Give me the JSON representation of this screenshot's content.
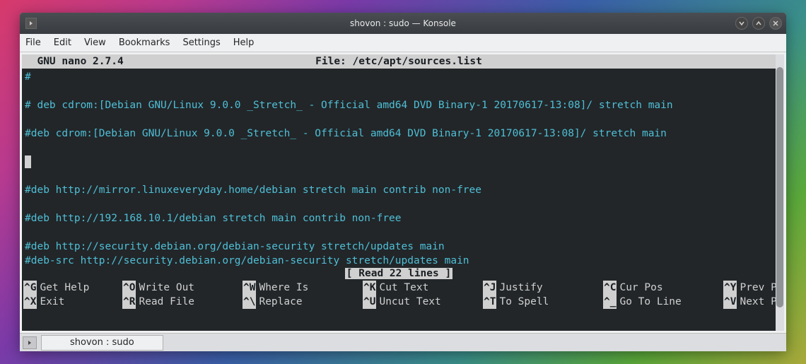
{
  "window": {
    "title": "shovon : sudo — Konsole"
  },
  "menubar": {
    "items": [
      "File",
      "Edit",
      "View",
      "Bookmarks",
      "Settings",
      "Help"
    ]
  },
  "nano": {
    "app_name": "  GNU nano 2.7.4",
    "file_label": "File: /etc/apt/sources.list",
    "lines": [
      "#",
      "",
      "# deb cdrom:[Debian GNU/Linux 9.0.0 _Stretch_ - Official amd64 DVD Binary-1 20170617-13:08]/ stretch main",
      "",
      "#deb cdrom:[Debian GNU/Linux 9.0.0 _Stretch_ - Official amd64 DVD Binary-1 20170617-13:08]/ stretch main",
      "",
      "",
      "",
      "#deb http://mirror.linuxeveryday.home/debian stretch main contrib non-free",
      "",
      "#deb http://192.168.10.1/debian stretch main contrib non-free",
      "",
      "#deb http://security.debian.org/debian-security stretch/updates main",
      "#deb-src http://security.debian.org/debian-security stretch/updates main"
    ],
    "cursor_line_index": 6,
    "status": "[ Read 22 lines ]",
    "shortcuts": [
      {
        "key": "^G",
        "label": "Get Help"
      },
      {
        "key": "^O",
        "label": "Write Out"
      },
      {
        "key": "^W",
        "label": "Where Is"
      },
      {
        "key": "^K",
        "label": "Cut Text"
      },
      {
        "key": "^J",
        "label": "Justify"
      },
      {
        "key": "^C",
        "label": "Cur Pos"
      },
      {
        "key": "^Y",
        "label": "Prev Page"
      },
      {
        "key": "^X",
        "label": "Exit"
      },
      {
        "key": "^R",
        "label": "Read File"
      },
      {
        "key": "^\\",
        "label": "Replace"
      },
      {
        "key": "^U",
        "label": "Uncut Text"
      },
      {
        "key": "^T",
        "label": "To Spell"
      },
      {
        "key": "^_",
        "label": "Go To Line"
      },
      {
        "key": "^V",
        "label": "Next Page"
      }
    ]
  },
  "tab": {
    "label": "shovon : sudo"
  }
}
